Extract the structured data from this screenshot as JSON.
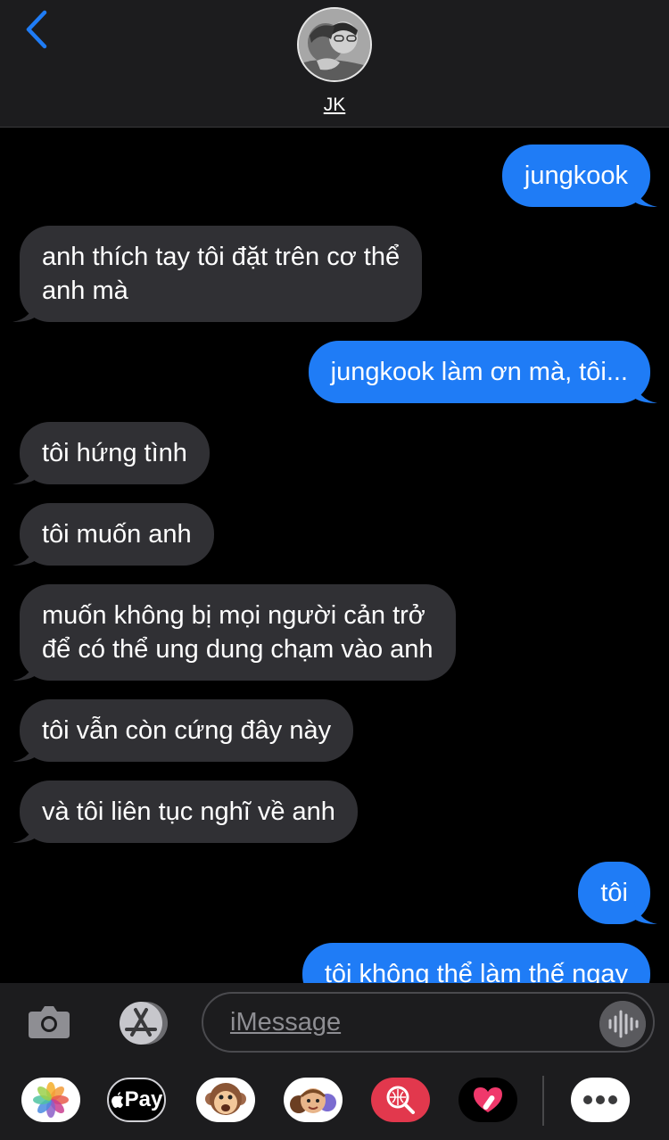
{
  "header": {
    "contact_name": "JK"
  },
  "messages": [
    {
      "from": "me",
      "lines": [
        "jungkook"
      ]
    },
    {
      "from": "them",
      "lines": [
        "anh thích tay tôi đặt trên cơ thể",
        "anh mà"
      ]
    },
    {
      "from": "me",
      "lines": [
        "jungkook làm ơn mà, tôi..."
      ]
    },
    {
      "from": "them",
      "lines": [
        "tôi hứng tình"
      ]
    },
    {
      "from": "them",
      "lines": [
        "tôi muốn anh"
      ]
    },
    {
      "from": "them",
      "lines": [
        "muốn không bị mọi người cản trở",
        "để có thể ung dung chạm vào anh"
      ]
    },
    {
      "from": "them",
      "lines": [
        "tôi vẫn còn cứng đây này"
      ]
    },
    {
      "from": "them",
      "lines": [
        "và tôi liên tục nghĩ về anh"
      ]
    },
    {
      "from": "me",
      "lines": [
        "tôi"
      ]
    },
    {
      "from": "me",
      "lines": [
        "tôi không thể làm thế ngay"
      ]
    }
  ],
  "input": {
    "placeholder": "iMessage"
  },
  "apps": {
    "icons": [
      "photos-icon",
      "apple-pay-icon",
      "animoji-icon",
      "memoji-icon",
      "image-search-icon",
      "digital-touch-icon",
      "more-icon"
    ],
    "apple_pay_label": "Pay"
  },
  "colors": {
    "sent_bubble": "#1f7cf6",
    "received_bubble": "#303034",
    "accent": "#1f7cf6"
  }
}
